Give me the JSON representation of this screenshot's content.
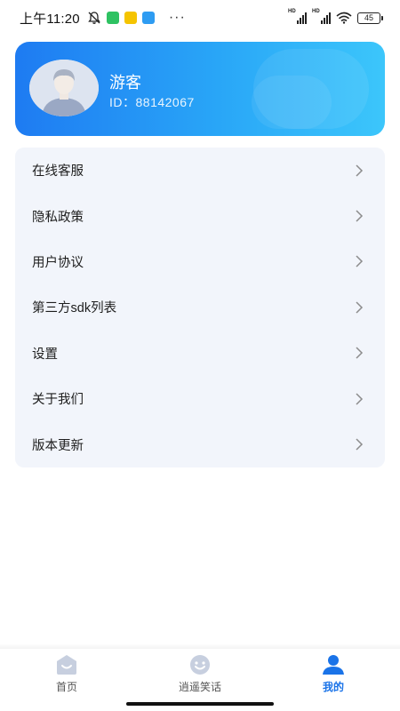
{
  "status_bar": {
    "time": "上午11:20",
    "dots": "···",
    "battery": "45",
    "signal_tag": "HD"
  },
  "profile": {
    "username": "游客",
    "user_id": "ID：88142067"
  },
  "menu": [
    {
      "label": "在线客服"
    },
    {
      "label": "隐私政策"
    },
    {
      "label": "用户协议"
    },
    {
      "label": "第三方sdk列表"
    },
    {
      "label": "设置"
    },
    {
      "label": "关于我们"
    },
    {
      "label": "版本更新"
    }
  ],
  "bottom_nav": [
    {
      "label": "首页",
      "icon": "home-icon",
      "active": false
    },
    {
      "label": "逍遥笑话",
      "icon": "smile-icon",
      "active": false
    },
    {
      "label": "我的",
      "icon": "profile-icon",
      "active": true
    }
  ],
  "colors": {
    "accent": "#1a73e8",
    "card_gradient_start": "#1e7bf2",
    "card_gradient_end": "#3cc6fb",
    "menu_background": "#f2f5fb"
  }
}
